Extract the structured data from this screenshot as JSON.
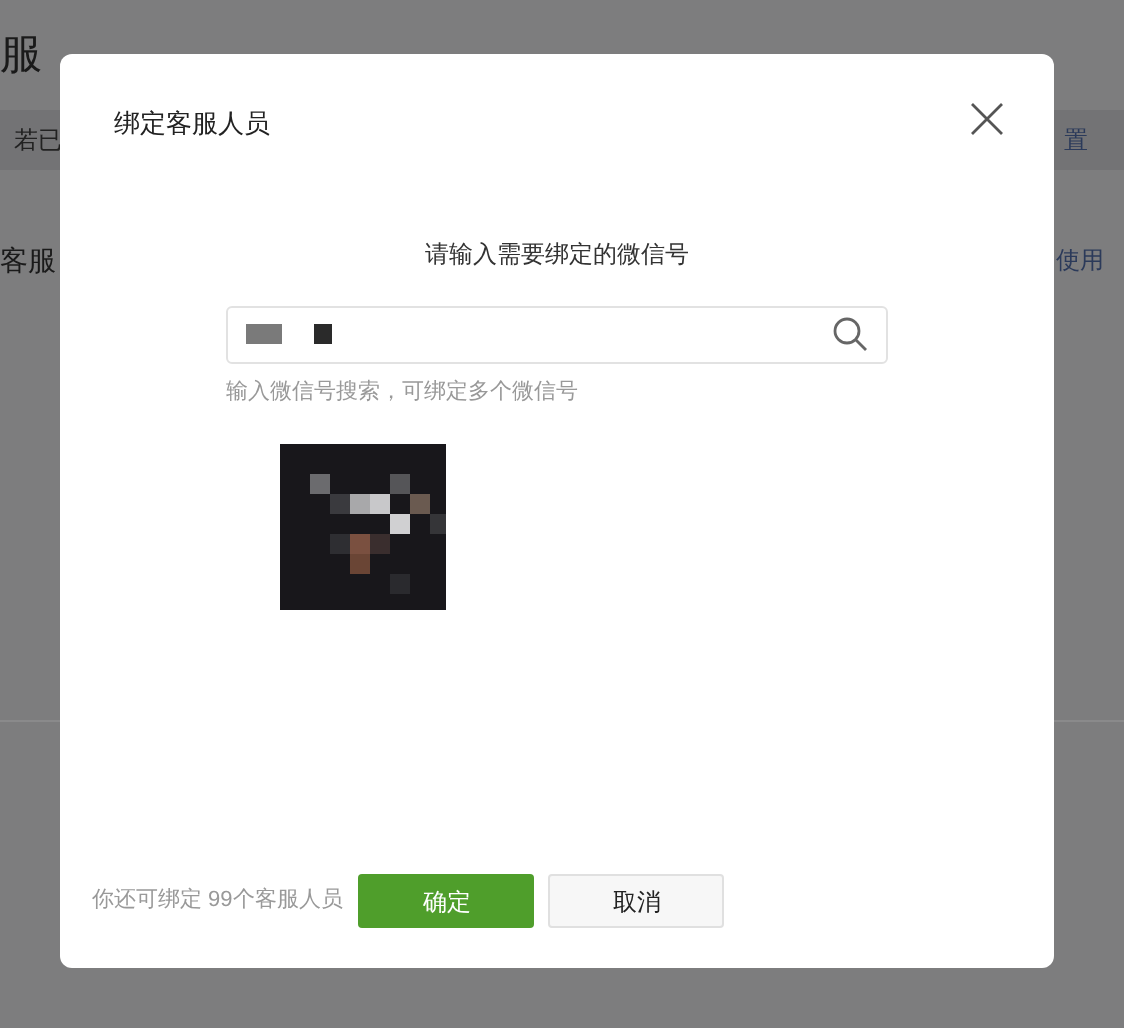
{
  "background_page": {
    "title": "服",
    "notice": "若已",
    "notice_link": "置",
    "section_title": "客服",
    "help_link": "使用"
  },
  "dialog": {
    "title": "绑定客服人员",
    "prompt": "请输入需要绑定的微信号",
    "search": {
      "redacted": true
    },
    "hint": "输入微信号搜索，可绑定多个微信号",
    "remaining": "你还可绑定 99个客服人员",
    "buttons": [
      {
        "label": "确定",
        "kind": "primary"
      },
      {
        "label": "取消",
        "kind": "default"
      }
    ]
  }
}
